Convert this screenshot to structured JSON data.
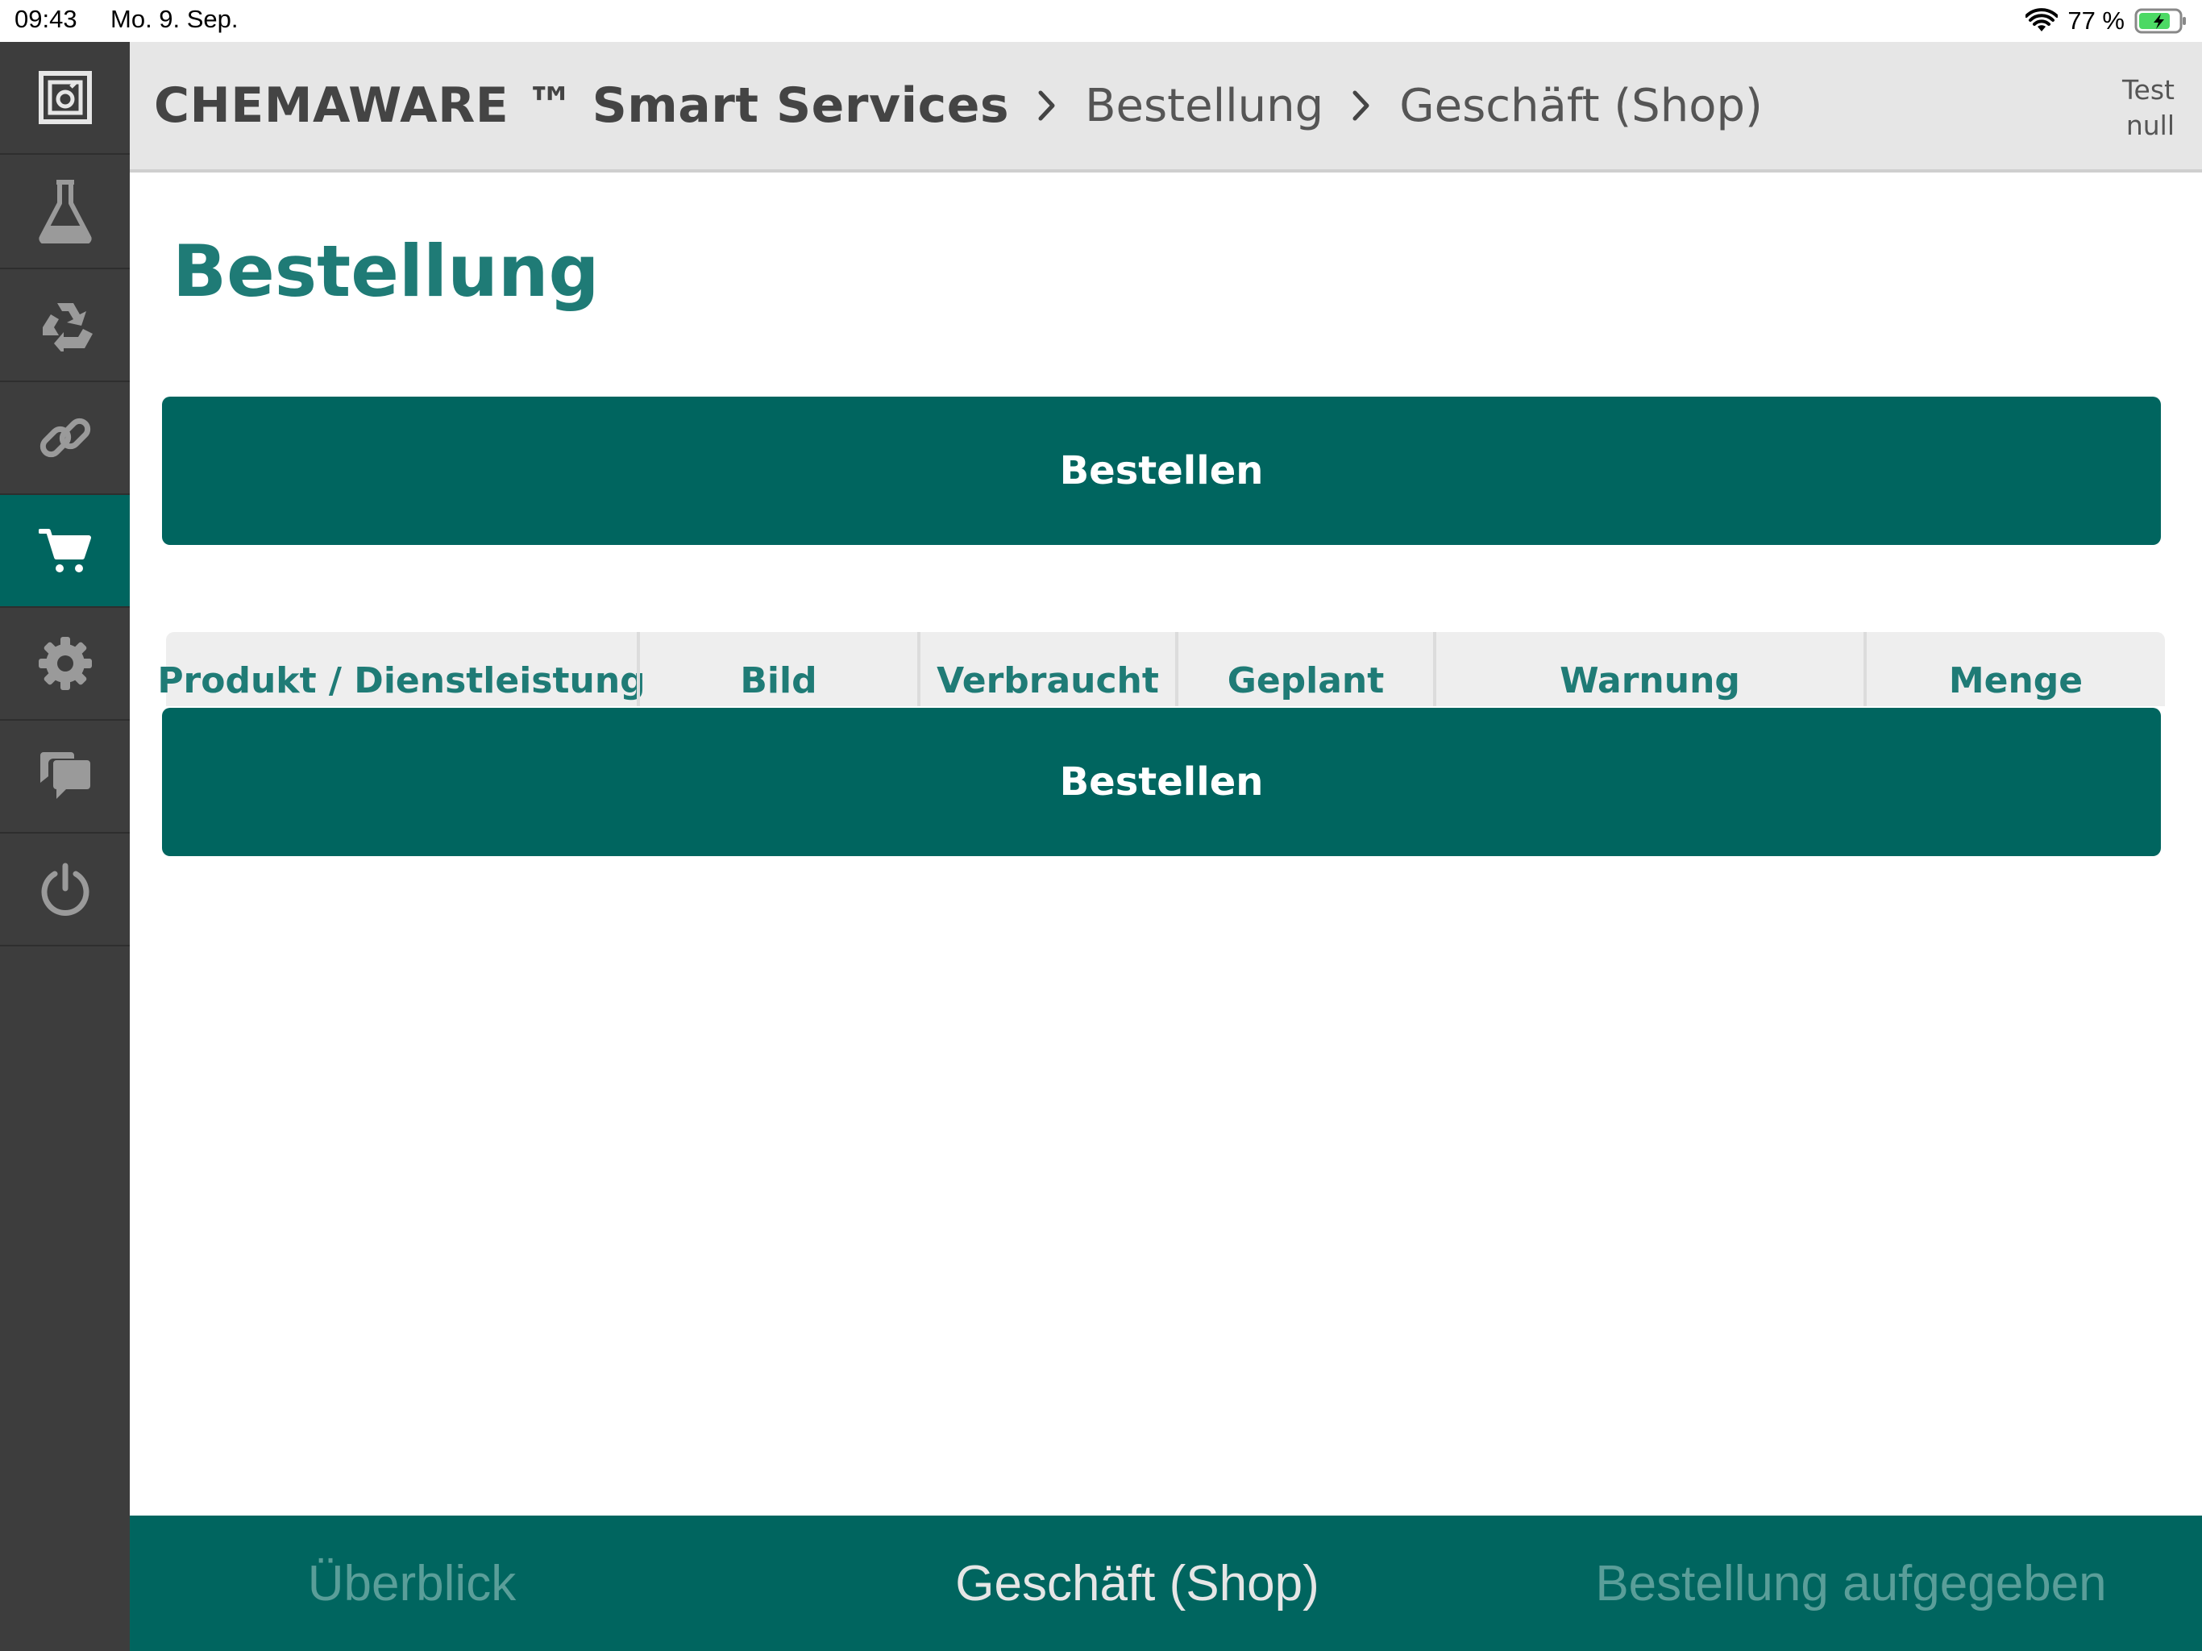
{
  "status_bar": {
    "time": "09:43",
    "date": "Mo. 9. Sep.",
    "battery": "77 %"
  },
  "sidebar": {
    "items": [
      {
        "icon": "app-logo-icon",
        "active": false
      },
      {
        "icon": "flask-icon",
        "active": false
      },
      {
        "icon": "recycle-icon",
        "active": false
      },
      {
        "icon": "link-icon",
        "active": false
      },
      {
        "icon": "cart-icon",
        "active": true
      },
      {
        "icon": "gear-icon",
        "active": false
      },
      {
        "icon": "chat-icon",
        "active": false
      },
      {
        "icon": "power-icon",
        "active": false
      }
    ]
  },
  "header": {
    "brand": "CHEMAWARE ™ Smart Services",
    "breadcrumbs": [
      "Bestellung",
      "Geschäft (Shop)"
    ],
    "user_line1": "Test",
    "user_line2": "null"
  },
  "main": {
    "title": "Bestellung",
    "order_button_top": "Bestellen",
    "order_button_bottom": "Bestellen",
    "table_columns": [
      "Produkt / Dienstleistung",
      "Bild",
      "Verbraucht",
      "Geplant",
      "Warnung",
      "Menge"
    ]
  },
  "bottom_nav": {
    "tabs": [
      "Überblick",
      "Geschäft (Shop)",
      "Bestellung aufgegeben"
    ],
    "active_tab": "Geschäft (Shop)"
  },
  "colors": {
    "primary": "#00655f",
    "accent_text": "#1f7b76",
    "sidebar_bg": "#3d3d3d",
    "header_bg": "#e6e6e6"
  }
}
